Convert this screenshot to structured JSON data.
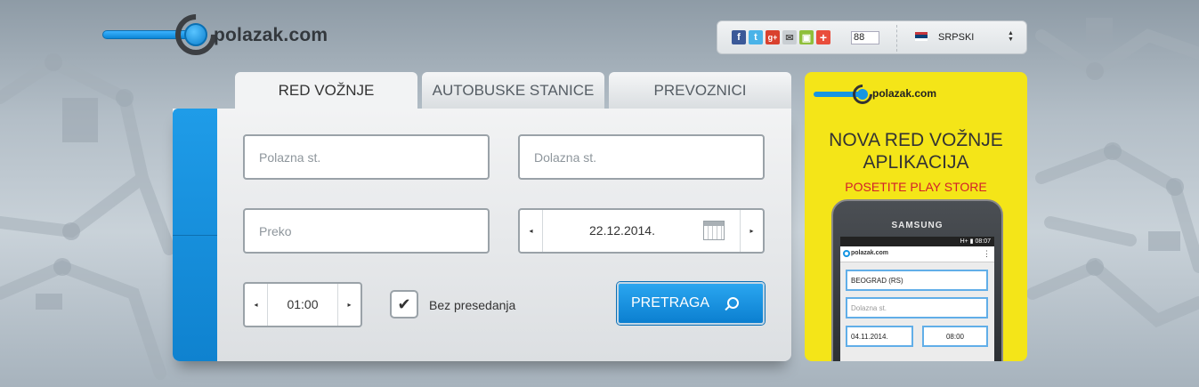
{
  "logo": {
    "text": "polazak.com"
  },
  "topbar": {
    "social_icons": [
      "facebook-icon",
      "twitter-icon",
      "google-plus-icon",
      "email-icon",
      "android-icon",
      "plus-share-icon"
    ],
    "share_count": "88",
    "language": "SRPSKI",
    "lang_arrows": "▲▼"
  },
  "tabs": [
    {
      "label": "RED VOŽNJE"
    },
    {
      "label": "AUTOBUSKE STANICE"
    },
    {
      "label": "PREVOZNICI"
    }
  ],
  "form": {
    "departure_placeholder": "Polazna st.",
    "arrival_placeholder": "Dolazna st.",
    "via_placeholder": "Preko",
    "date": "22.12.2014.",
    "time": "01:00",
    "direct_label": "Bez presedanja",
    "direct_checked": "✔",
    "search_label": "PRETRAGA",
    "arrow_left": "◂",
    "arrow_right": "▸"
  },
  "ad": {
    "logo_text": "polazak.com",
    "title_line1": "NOVA RED VOŽNJE",
    "title_line2": "APLIKACIJA",
    "subtitle": "POSETITE PLAY STORE",
    "phone_brand": "SAMSUNG",
    "status_time": "H+ ▮ 08:07",
    "app_logo": "polazak.com",
    "app_menu": "⋮",
    "from_value": "BEOGRAD (RS)",
    "to_placeholder": "Dolazna st.",
    "date_value": "04.11.2014.",
    "time_value": "08:00"
  },
  "colors": {
    "accent": "#1695e2",
    "ad_bg": "#f4e518",
    "ad_sub": "#d2202a"
  }
}
